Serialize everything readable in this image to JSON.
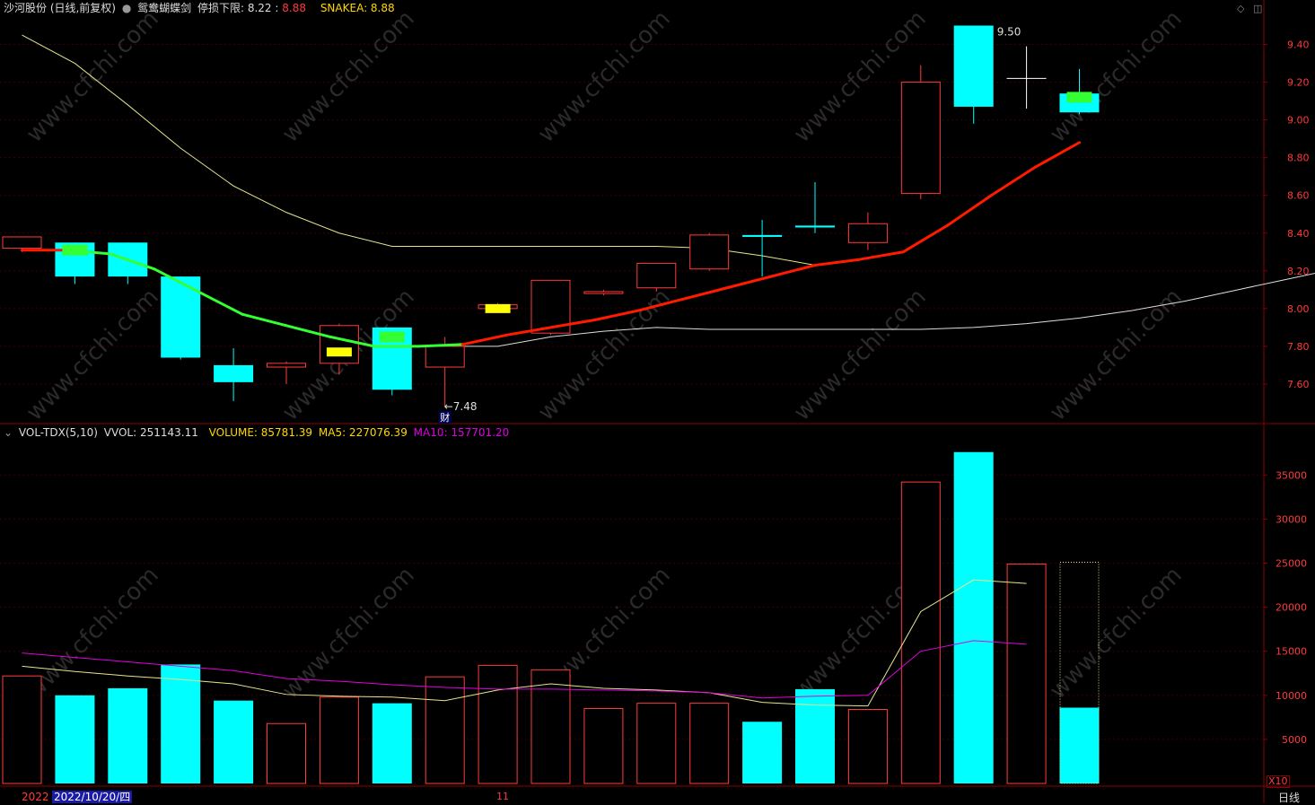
{
  "header": {
    "title": "沙河股份 (日线,前复权)",
    "indicator_name": "鸳鸯蝴蝶剑",
    "stop_label": "停损下限: 8.22",
    "sep": ":",
    "stop_value": "8.88",
    "snake_label": "SNAKEA: 8.88"
  },
  "vol_header": {
    "name": "VOL-TDX(5,10)",
    "vvol": "VVOL: 251143.11",
    "volume": "VOLUME: 85781.39",
    "ma5": "MA5: 227076.39",
    "ma10": "MA10: 157701.20"
  },
  "footer": {
    "date_partial": "2022",
    "date_selected": "2022/10/20/四",
    "month_mark": "11",
    "period": "日线",
    "unit_multiplier": "X10"
  },
  "colors": {
    "up": "#ff3b3b",
    "down": "#00ffff",
    "grid": "#3a0000",
    "axis": "#8b0000",
    "ma_yellow": "#e6e68c",
    "ma_white": "#dddddd",
    "snake_red": "#ff1a00",
    "snake_green": "#33ff33",
    "ma10_magenta": "#e000e0",
    "text_yellow": "#ffff00"
  },
  "chart_data": [
    {
      "type": "candlestick",
      "y_ticks": [
        7.6,
        7.8,
        8.0,
        8.2,
        8.4,
        8.6,
        8.8,
        9.0,
        9.2,
        9.4
      ],
      "ylim": [
        7.4,
        9.55
      ],
      "candles": [
        {
          "o": 8.32,
          "h": 8.38,
          "l": 8.3,
          "c": 8.38,
          "dir": "up"
        },
        {
          "o": 8.35,
          "h": 8.35,
          "l": 8.13,
          "c": 8.17,
          "dir": "down"
        },
        {
          "o": 8.35,
          "h": 8.35,
          "l": 8.13,
          "c": 8.17,
          "dir": "down"
        },
        {
          "o": 8.17,
          "h": 8.17,
          "l": 7.73,
          "c": 7.74,
          "dir": "down"
        },
        {
          "o": 7.7,
          "h": 7.79,
          "l": 7.51,
          "c": 7.61,
          "dir": "down"
        },
        {
          "o": 7.69,
          "h": 7.72,
          "l": 7.6,
          "c": 7.71,
          "dir": "up"
        },
        {
          "o": 7.71,
          "h": 7.92,
          "l": 7.65,
          "c": 7.91,
          "dir": "up"
        },
        {
          "o": 7.9,
          "h": 7.9,
          "l": 7.54,
          "c": 7.57,
          "dir": "down"
        },
        {
          "o": 7.69,
          "h": 7.85,
          "l": 7.48,
          "c": 7.8,
          "dir": "up"
        },
        {
          "o": 8.0,
          "h": 8.03,
          "l": 7.99,
          "c": 8.02,
          "dir": "up"
        },
        {
          "o": 7.87,
          "h": 8.15,
          "l": 7.86,
          "c": 8.15,
          "dir": "up"
        },
        {
          "o": 8.08,
          "h": 8.1,
          "l": 8.07,
          "c": 8.09,
          "dir": "up"
        },
        {
          "o": 8.11,
          "h": 8.24,
          "l": 8.09,
          "c": 8.24,
          "dir": "up"
        },
        {
          "o": 8.21,
          "h": 8.4,
          "l": 8.2,
          "c": 8.39,
          "dir": "up"
        },
        {
          "o": 8.38,
          "h": 8.47,
          "l": 8.17,
          "c": 8.39,
          "dir": "down"
        },
        {
          "o": 8.44,
          "h": 8.67,
          "l": 8.4,
          "c": 8.43,
          "dir": "down"
        },
        {
          "o": 8.35,
          "h": 8.51,
          "l": 8.31,
          "c": 8.45,
          "dir": "up"
        },
        {
          "o": 8.61,
          "h": 9.29,
          "l": 8.58,
          "c": 9.2,
          "dir": "up"
        },
        {
          "o": 9.5,
          "h": 9.5,
          "l": 8.98,
          "c": 9.07,
          "dir": "down"
        },
        {
          "o": 9.22,
          "h": 9.39,
          "l": 9.06,
          "c": 9.22,
          "dir": "doji"
        },
        {
          "o": 9.14,
          "h": 9.27,
          "l": 9.03,
          "c": 9.04,
          "dir": "down"
        }
      ],
      "high_label": "9.50",
      "low_label": "←7.48",
      "event_label": "财",
      "lines": {
        "upper_yellow": [
          9.45,
          9.3,
          9.08,
          8.85,
          8.65,
          8.51,
          8.4,
          8.33,
          8.33,
          8.33,
          8.33,
          8.33,
          8.33,
          8.32,
          8.28,
          8.23
        ],
        "lower_white": [
          7.8,
          7.8,
          7.85,
          7.88,
          7.9,
          7.89,
          7.89,
          7.89,
          7.89,
          7.89,
          7.9,
          7.92,
          7.95,
          7.99,
          8.04,
          8.1,
          8.16,
          8.22
        ],
        "snake": [
          8.31,
          8.31,
          8.29,
          8.21,
          8.09,
          7.97,
          7.91,
          7.85,
          7.8,
          7.8,
          7.81,
          7.86,
          7.9,
          7.94,
          7.99,
          8.05,
          8.11,
          8.17,
          8.23,
          8.26,
          8.3,
          8.44,
          8.6,
          8.75,
          8.88
        ],
        "snake_colors": [
          "red",
          "green",
          "green",
          "green",
          "green",
          "green",
          "green",
          "green",
          "green",
          "green",
          "red",
          "red",
          "red",
          "red",
          "red",
          "red",
          "red",
          "red",
          "red",
          "red",
          "red",
          "red",
          "red",
          "red"
        ]
      },
      "markers": [
        {
          "i": 1,
          "value": 8.31,
          "color": "green"
        },
        {
          "i": 7,
          "value": 7.85,
          "color": "green"
        },
        {
          "i": 6,
          "value": 7.77,
          "color": "yellow"
        },
        {
          "i": 9,
          "value": 8.0,
          "color": "yellow"
        },
        {
          "i": 20,
          "value": 9.12,
          "color": "green"
        }
      ]
    },
    {
      "type": "bar",
      "name": "VOL",
      "y_ticks": [
        5000,
        10000,
        15000,
        20000,
        25000,
        30000,
        35000
      ],
      "ylim": [
        0,
        39000
      ],
      "values": [
        12200,
        10000,
        10800,
        13500,
        9400,
        6800,
        9800,
        9100,
        12100,
        13400,
        12900,
        8500,
        9100,
        9100,
        7000,
        10700,
        8400,
        34200,
        37600,
        24900,
        8600
      ],
      "dir": [
        "up",
        "down",
        "down",
        "down",
        "down",
        "up",
        "up",
        "down",
        "up",
        "up",
        "up",
        "up",
        "up",
        "up",
        "down",
        "down",
        "up",
        "up",
        "down",
        "up",
        "down"
      ],
      "ma5": [
        13300,
        12700,
        12200,
        11800,
        11300,
        10100,
        9900,
        9800,
        9400,
        10600,
        11300,
        10800,
        10600,
        10300,
        9200,
        8900,
        8800,
        19500,
        23100,
        22700
      ],
      "ma10": [
        14800,
        14300,
        13800,
        13300,
        12800,
        11900,
        11600,
        11200,
        10900,
        10700,
        10700,
        10600,
        10500,
        10300,
        9700,
        9900,
        10000,
        15000,
        16200,
        15800
      ]
    }
  ]
}
